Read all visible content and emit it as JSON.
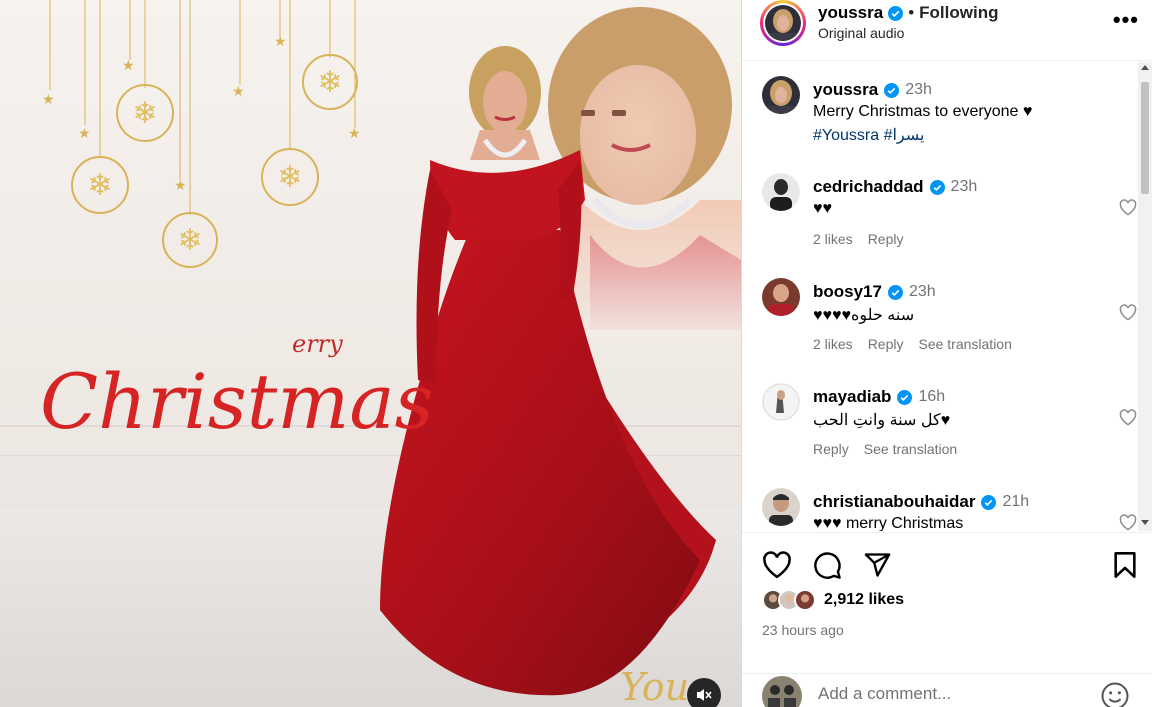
{
  "header": {
    "username": "youssra",
    "separator": "•",
    "follow_status": "Following",
    "audio": "Original audio",
    "more": "•••"
  },
  "caption": {
    "username": "youssra",
    "time": "23h",
    "text": "Merry Christmas to everyone ♥",
    "tags": "#Youssra #يسرا"
  },
  "comments": [
    {
      "username": "cedrichaddad",
      "time": "23h",
      "text": "♥♥",
      "likes": "2 likes",
      "reply": "Reply",
      "translate": ""
    },
    {
      "username": "boosy17",
      "time": "23h",
      "text": "♥♥♥♥سنه حلوه",
      "likes": "2 likes",
      "reply": "Reply",
      "translate": "See translation"
    },
    {
      "username": "mayadiab",
      "time": "16h",
      "text": "كل سنة وانتِ الحب♥",
      "likes": "",
      "reply": "Reply",
      "translate": "See translation"
    },
    {
      "username": "christianabouhaidar",
      "time": "21h",
      "text": "♥♥♥ merry Christmas",
      "likes": "",
      "reply": "",
      "translate": ""
    }
  ],
  "actions": {
    "likes_count": "2,912 likes",
    "posted_ago": "23 hours ago",
    "add_comment_placeholder": "Add a comment..."
  },
  "media": {
    "greeting_small": "erry",
    "greeting_big": "Christmas",
    "signature": "Yous"
  },
  "icons": {
    "like": "heart-icon",
    "comment": "comment-icon",
    "share": "share-icon",
    "save": "bookmark-icon",
    "emoji": "emoji-icon",
    "mute": "muted-speaker-icon"
  },
  "colors": {
    "verified": "#0095f6",
    "link": "#00376b",
    "dress": "#b3121c",
    "gold": "#d9b35a"
  }
}
